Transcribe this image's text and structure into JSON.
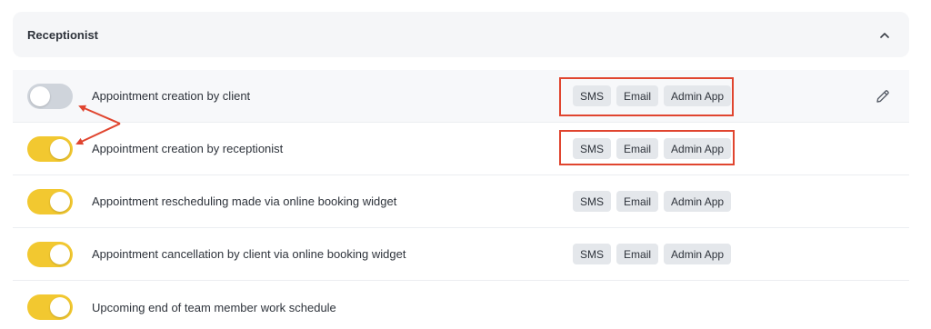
{
  "section": {
    "title": "Receptionist",
    "chevron_icon": "chevron-up-icon"
  },
  "notifications": [
    {
      "label": "Appointment creation by client",
      "enabled": false,
      "channels": [
        "SMS",
        "Email",
        "Admin App"
      ],
      "highlighted": true,
      "edit_icon": "pencil-icon"
    },
    {
      "label": "Appointment creation by receptionist",
      "enabled": true,
      "channels": [
        "SMS",
        "Email",
        "Admin App"
      ]
    },
    {
      "label": "Appointment rescheduling made via online booking widget",
      "enabled": true,
      "channels": [
        "SMS",
        "Email",
        "Admin App"
      ]
    },
    {
      "label": "Appointment cancellation by client via online booking widget",
      "enabled": true,
      "channels": [
        "SMS",
        "Email",
        "Admin App"
      ]
    },
    {
      "label": "Upcoming end of team member work schedule",
      "enabled": true,
      "channels": []
    }
  ],
  "colors": {
    "toggle_on": "#f2c830",
    "toggle_off": "#cfd4db",
    "annotation_red": "#e0452f",
    "tag_bg": "#e4e7eb"
  }
}
